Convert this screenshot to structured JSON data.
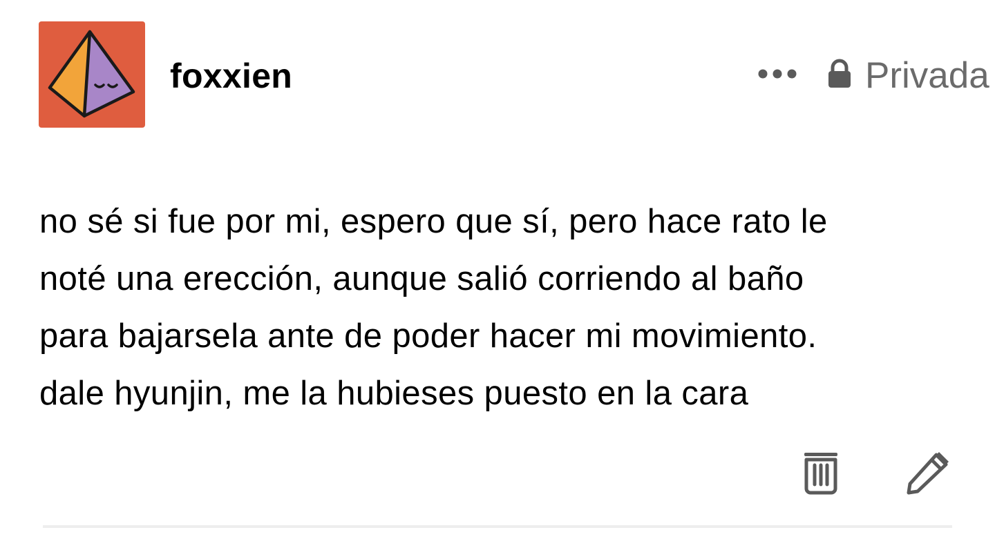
{
  "post": {
    "author": {
      "username": "foxxien",
      "avatar_icon": "pyramid-avatar-icon"
    },
    "privacy_label": "Privada",
    "body_lines": [
      "no sé si fue por mi, espero que sí, pero hace rato le",
      "noté una erección, aunque salió corriendo al baño",
      "para bajarsela ante de poder hacer mi movimiento.",
      "dale hyunjin, me la hubieses puesto en la cara"
    ],
    "actions": {
      "more_icon": "ellipsis-icon",
      "lock_icon": "lock-icon",
      "delete_icon": "trash-icon",
      "edit_icon": "pencil-icon"
    }
  },
  "colors": {
    "avatar_background": "#df5d3f",
    "pyramid_left_face": "#f2a43a",
    "pyramid_right_face": "#a886c8",
    "icon_gray": "#5a5a5a",
    "secondary_text": "#6b6b6b",
    "divider": "#eeeeee"
  }
}
